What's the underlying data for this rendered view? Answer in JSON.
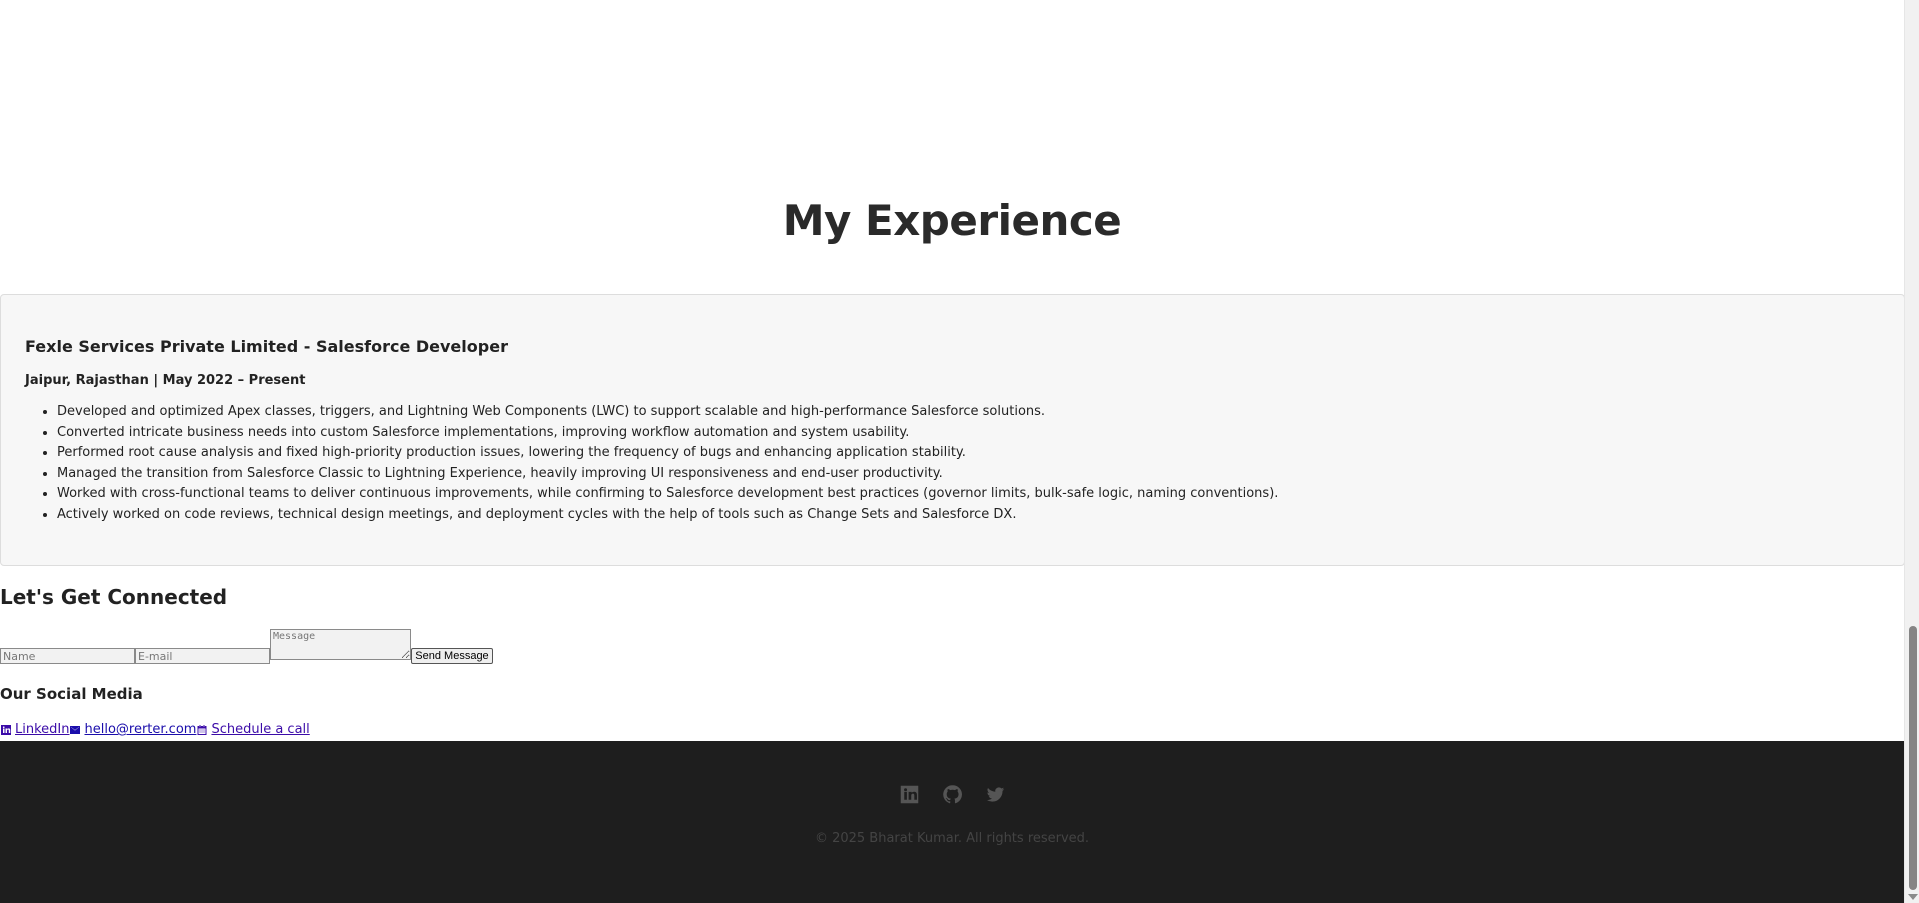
{
  "experience": {
    "heading": "My Experience",
    "job_title": "Fexle Services Private Limited - Salesforce Developer",
    "job_meta": "Jaipur, Rajasthan | May 2022 – Present",
    "duties": [
      "Developed and optimized Apex classes, triggers, and Lightning Web Components (LWC) to support scalable and high-performance Salesforce solutions.",
      "Converted intricate business needs into custom Salesforce implementations, improving workflow automation and system usability.",
      "Performed root cause analysis and fixed high-priority production issues, lowering the frequency of bugs and enhancing application stability.",
      "Managed the transition from Salesforce Classic to Lightning Experience, heavily improving UI responsiveness and end-user productivity.",
      "Worked with cross-functional teams to deliver continuous improvements, while confirming to Salesforce development best practices (governor limits, bulk-safe logic, naming conventions).",
      "Actively worked on code reviews, technical design meetings, and deployment cycles with the help of tools such as Change Sets and Salesforce DX."
    ]
  },
  "contact": {
    "heading": "Let's Get Connected",
    "name_placeholder": "Name",
    "email_placeholder": "E-mail",
    "message_placeholder": "Message",
    "send_label": "Send Message"
  },
  "social": {
    "heading": "Our Social Media",
    "links": [
      {
        "label": " LinkedIn",
        "icon": "linkedin-icon"
      },
      {
        "label": " hello@rerter.com",
        "icon": "envelope-icon"
      },
      {
        "label": " Schedule a call",
        "icon": "calendar-icon"
      }
    ]
  },
  "footer": {
    "icons": [
      "linkedin-icon",
      "github-icon",
      "twitter-icon"
    ],
    "copyright": "© 2025 Bharat Kumar. All rights reserved."
  },
  "colors": {
    "footer_bg": "#1e1e1e",
    "card_bg": "#f7f7f7",
    "visited_link": "#3b0ba8",
    "link": "#1a0dab"
  }
}
